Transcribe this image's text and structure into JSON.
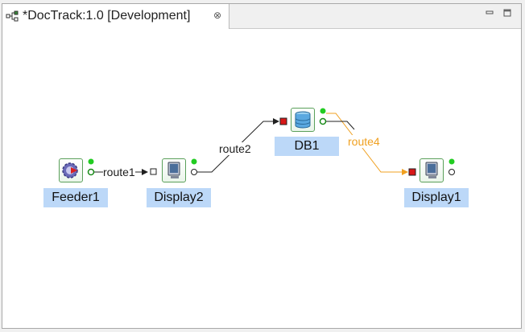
{
  "tab": {
    "title": "*DocTrack:1.0 [Development]",
    "close_glyph": "⊗"
  },
  "colors": {
    "selection": "#bcd8f8",
    "port_active": "#22cc22",
    "port_input": "#d81818",
    "route_highlight": "#f0a020",
    "wire": "#202020"
  },
  "nodes": {
    "feeder1": {
      "label": "Feeder1",
      "icon": "feeder-gear-icon"
    },
    "display2": {
      "label": "Display2",
      "icon": "monitor-icon"
    },
    "db1": {
      "label": "DB1",
      "icon": "database-icon"
    },
    "display1": {
      "label": "Display1",
      "icon": "monitor-icon"
    }
  },
  "routes": {
    "route1": {
      "label": "route1"
    },
    "route2": {
      "label": "route2"
    },
    "route4": {
      "label": "route4"
    }
  }
}
